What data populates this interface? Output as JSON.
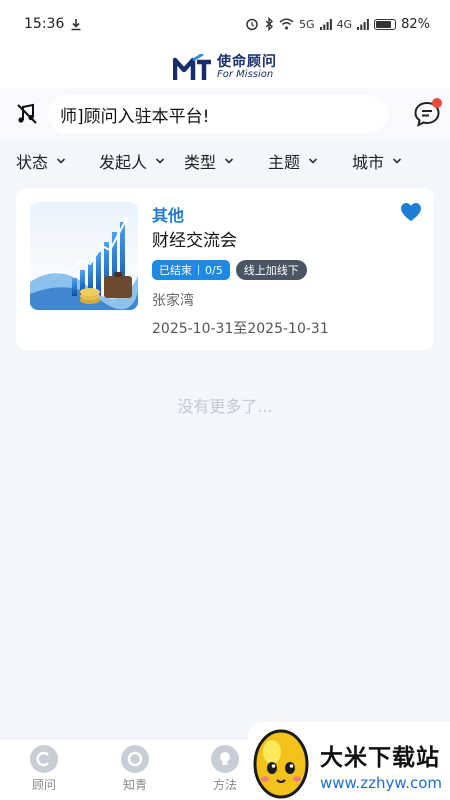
{
  "status_bar": {
    "time": "15:36",
    "battery": "82%",
    "battery_level": 0.82,
    "signal_labels": [
      "5G",
      "4G"
    ]
  },
  "brand": {
    "name_cn": "使命顾问",
    "name_en": "For Mission",
    "color": "#1a2d6b"
  },
  "search": {
    "marquee_text": "师]顾问入驻本平台!"
  },
  "filters": [
    {
      "label": "状态"
    },
    {
      "label": "发起人"
    },
    {
      "label": "类型"
    },
    {
      "label": "主题"
    },
    {
      "label": "城市"
    }
  ],
  "event_card": {
    "category": "其他",
    "title": "财经交流会",
    "status_tag": "已结束",
    "count_tag": "0/5",
    "mode_tag": "线上加线下",
    "location": "张家湾",
    "dates": "2025-10-31至2025-10-31",
    "favorite_icon": "heart-icon",
    "accent": "#1e7ed4"
  },
  "list_end_text": "没有更多了...",
  "tabs": [
    {
      "label": "顾问",
      "icon": "c-logo-icon"
    },
    {
      "label": "知青",
      "icon": "ring-icon"
    },
    {
      "label": "方法",
      "icon": "bulb-icon"
    }
  ],
  "watermark": {
    "name": "大米下载站",
    "url": "www.zzhyw.com"
  }
}
